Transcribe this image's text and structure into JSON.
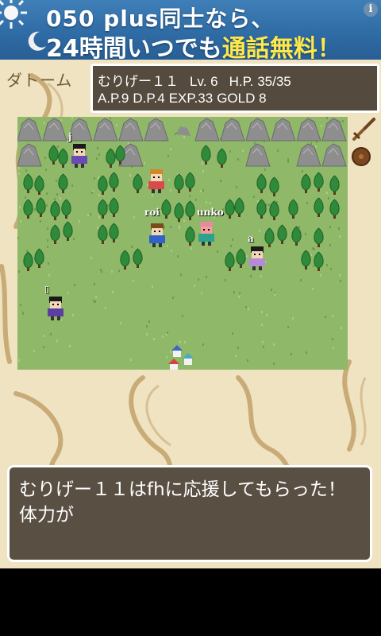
{
  "ad": {
    "line1": "050 plus同士なら、",
    "line2_part1": "24時間",
    "line2_part2": "いつでも",
    "line2_highlight": "通話無料！",
    "info_icon": "i"
  },
  "location": "ダトーム",
  "status": {
    "name": "むりげー１１",
    "level": "Lv. 6",
    "hp": "H.P. 35/35",
    "ap": "A.P.9",
    "dp": "D.P.4",
    "exp": "EXP.33",
    "gold": "GOLD 8"
  },
  "players": [
    {
      "name": "j"
    },
    {
      "name": "roi"
    },
    {
      "name": "unko"
    },
    {
      "name": "a"
    },
    {
      "name": "▯"
    }
  ],
  "equipment": {
    "weapon": "sword-icon",
    "shield": "shield-icon"
  },
  "message": {
    "line1": "むりげー１１はfhに応援してもらった！",
    "line2": "体力が"
  },
  "colors": {
    "grass": "#8fb869",
    "tree": "#2f8a3a",
    "rock": "#8e8e8e",
    "window": "#544a3d",
    "parchment": "#efe3c1"
  }
}
